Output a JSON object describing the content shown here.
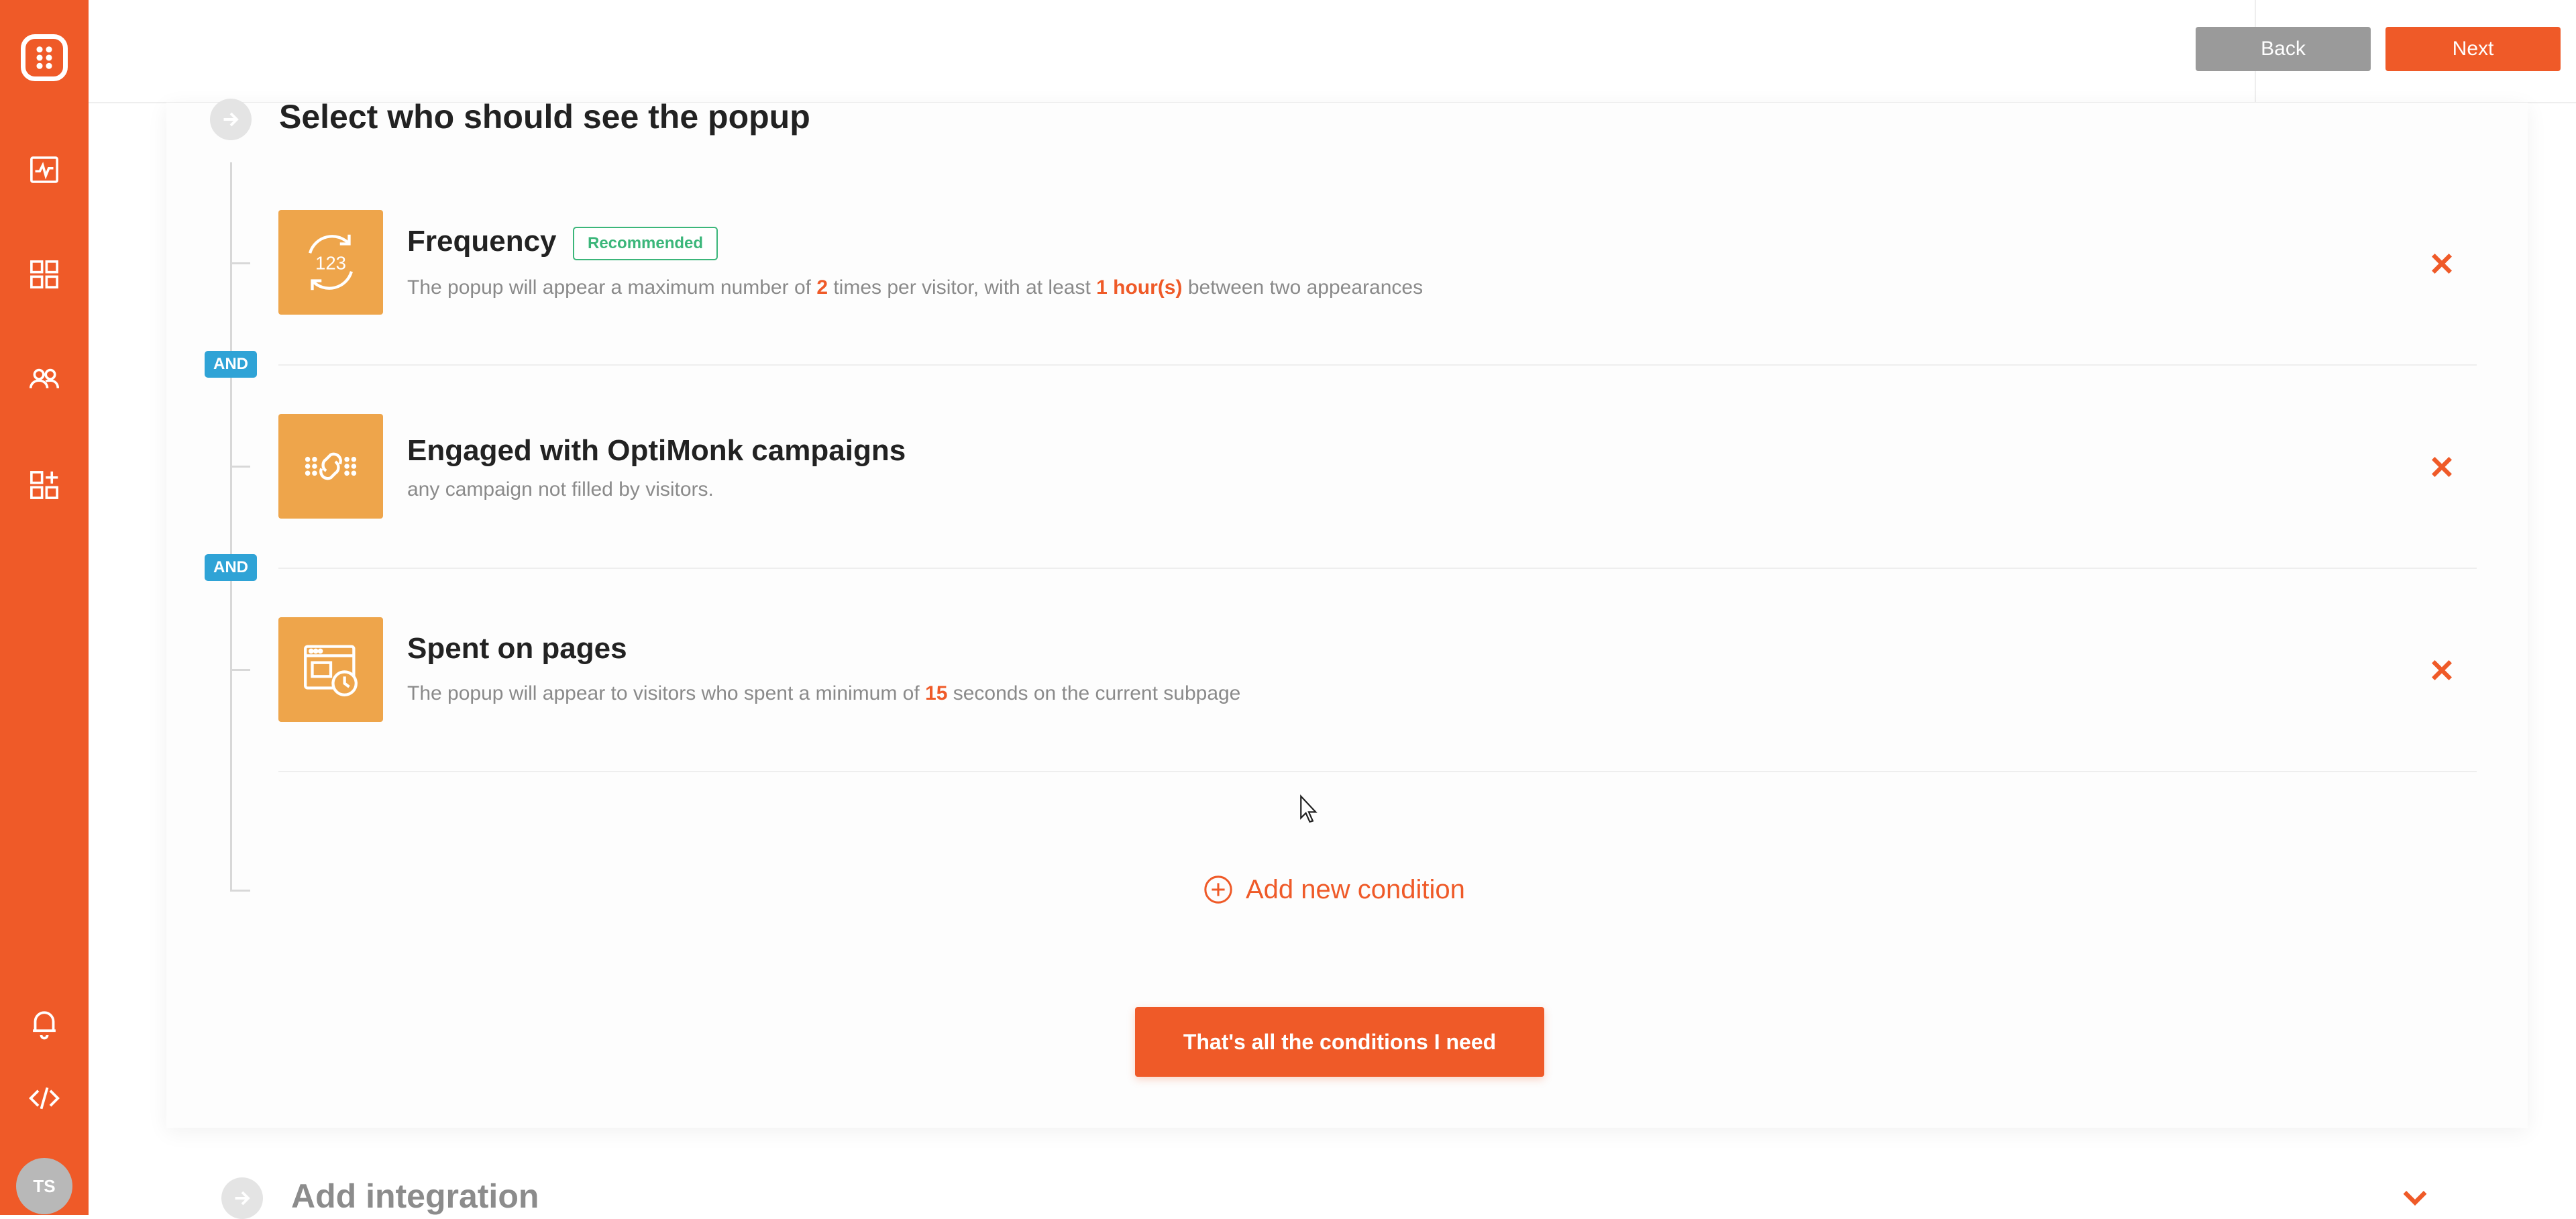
{
  "sidebar": {
    "items": [
      {
        "icon": "app-logo-icon"
      },
      {
        "icon": "analytics-icon"
      },
      {
        "icon": "campaigns-grid-icon"
      },
      {
        "icon": "subscribers-icon"
      },
      {
        "icon": "add-widget-icon"
      },
      {
        "icon": "bell-icon"
      },
      {
        "icon": "code-icon"
      }
    ],
    "avatar_initials": "TS"
  },
  "topbar": {
    "back_label": "Back",
    "next_label": "Next"
  },
  "section": {
    "title": "Select who should see the popup"
  },
  "conditions": [
    {
      "title": "Frequency",
      "badge": "Recommended",
      "icon": "frequency-123-icon",
      "desc_parts": [
        "The popup will appear a maximum number of ",
        "2",
        " times per visitor, with at least ",
        "1 hour(s)",
        " between two appearances"
      ]
    },
    {
      "title": "Engaged with OptiMonk campaigns",
      "icon": "engaged-link-icon",
      "desc": "any campaign not filled by visitors."
    },
    {
      "title": "Spent on pages",
      "icon": "browser-timer-icon",
      "desc_parts": [
        "The popup will appear to visitors who spent a minimum of ",
        "15",
        " seconds on the current subpage"
      ]
    }
  ],
  "and_label": "AND",
  "add_condition_label": "Add new condition",
  "done_button_label": "That's all the conditions I need",
  "next_section": {
    "title": "Add integration"
  },
  "colors": {
    "brand_orange": "#ef5a28",
    "icon_tile": "#eea54b",
    "and_blue": "#2fa3d6",
    "badge_green": "#3bb67a"
  }
}
